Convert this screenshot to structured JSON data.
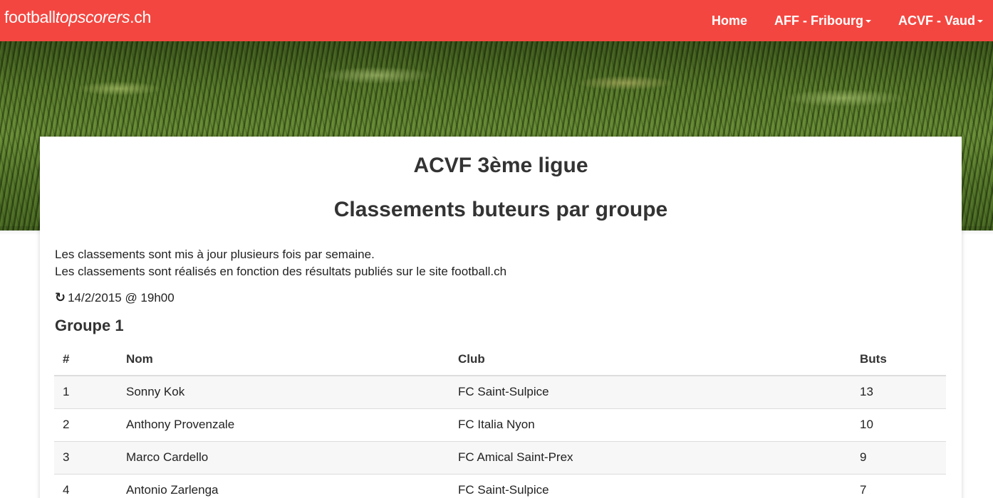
{
  "brand": {
    "part1": "football",
    "part2": "topscorers",
    "part3": ".ch"
  },
  "nav": [
    {
      "label": "Home",
      "dropdown": false
    },
    {
      "label": "AFF - Fribourg",
      "dropdown": true
    },
    {
      "label": "ACVF - Vaud",
      "dropdown": true
    }
  ],
  "page": {
    "title": "ACVF 3ème ligue",
    "subtitle": "Classements buteurs par groupe",
    "intro_line1": "Les classements sont mis à jour plusieurs fois par semaine.",
    "intro_line2": "Les classements sont réalisés en fonction des résultats publiés sur le site football.ch",
    "updated": "14/2/2015 @ 19h00",
    "refresh_icon": "↻"
  },
  "group": {
    "title": "Groupe 1",
    "headers": {
      "rank": "#",
      "name": "Nom",
      "club": "Club",
      "goals": "Buts"
    },
    "rows": [
      {
        "rank": "1",
        "name": "Sonny Kok",
        "club": "FC Saint-Sulpice",
        "goals": "13"
      },
      {
        "rank": "2",
        "name": "Anthony Provenzale",
        "club": "FC Italia Nyon",
        "goals": "10"
      },
      {
        "rank": "3",
        "name": "Marco Cardello",
        "club": "FC Amical Saint-Prex",
        "goals": "9"
      },
      {
        "rank": "4",
        "name": "Antonio Zarlenga",
        "club": "FC Saint-Sulpice",
        "goals": "7"
      }
    ]
  },
  "colors": {
    "navbar": "#f44640",
    "text": "#222222",
    "stripe": "#f7f7f7"
  }
}
